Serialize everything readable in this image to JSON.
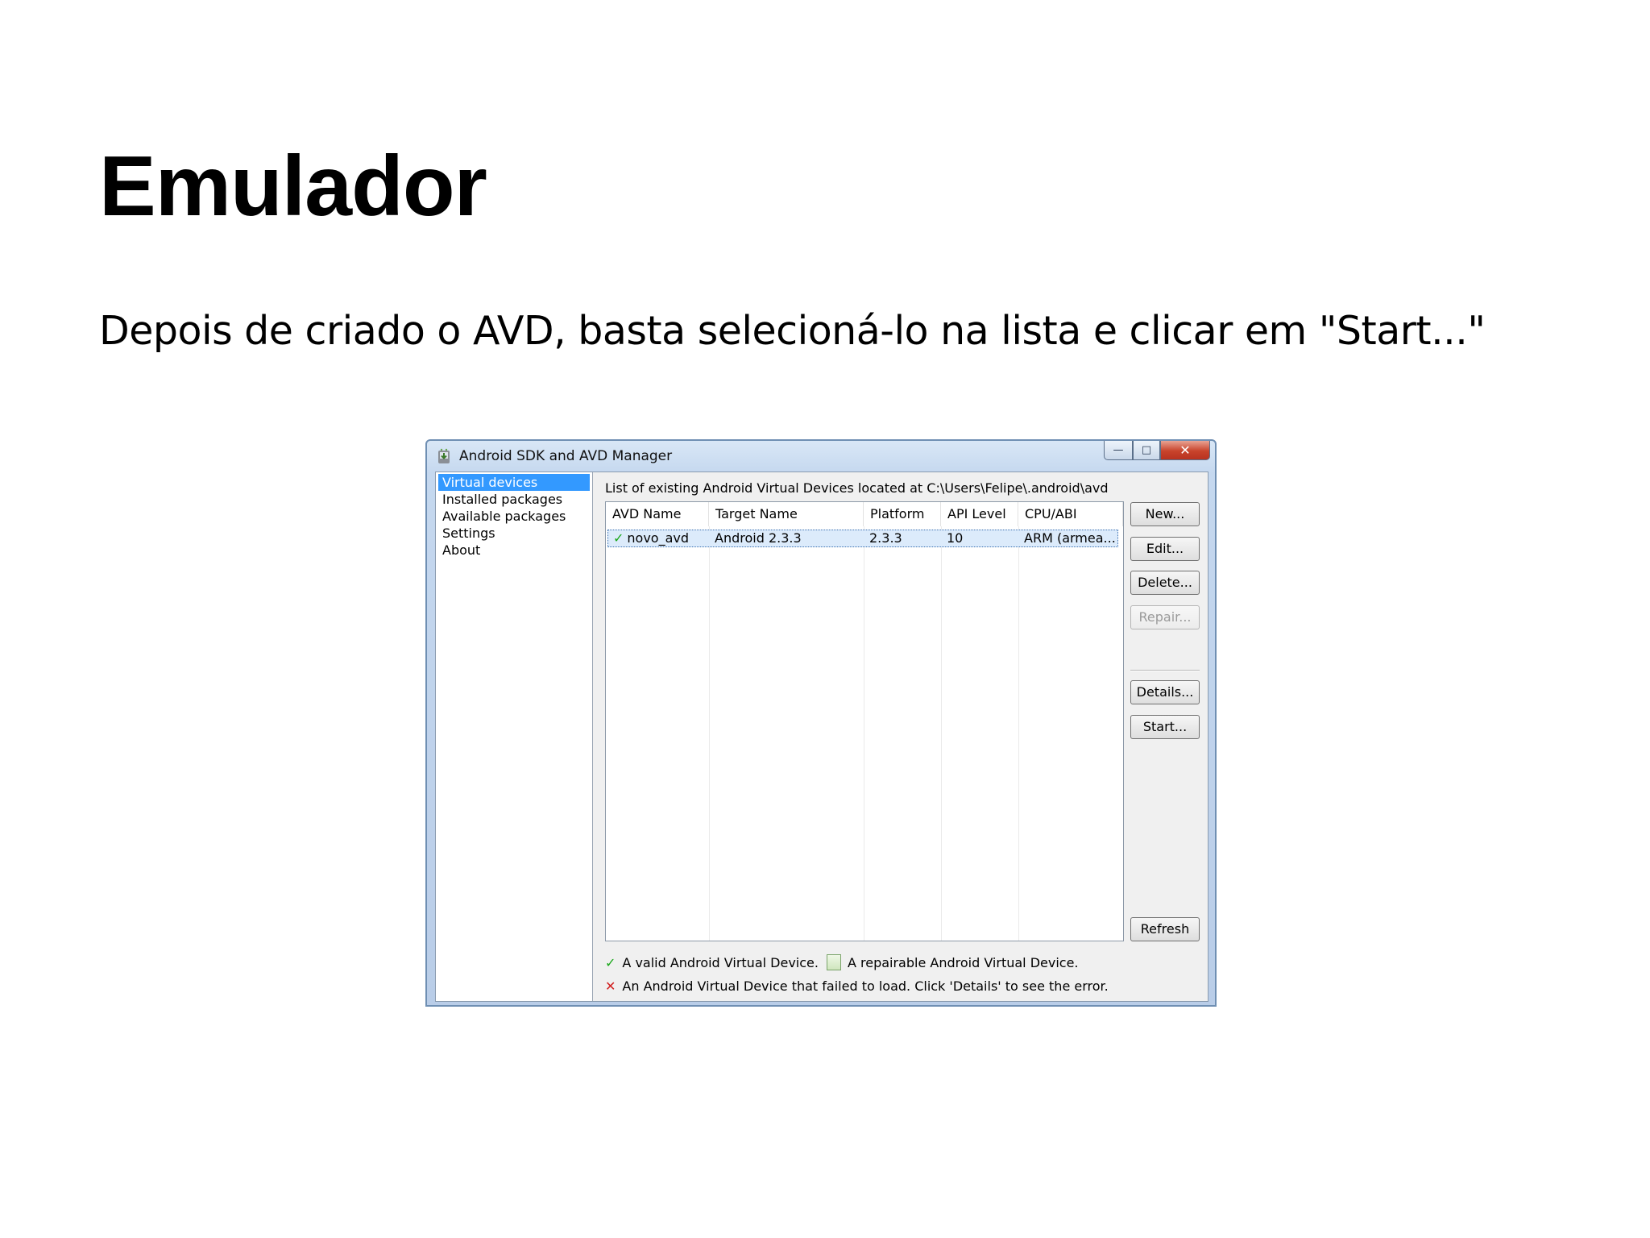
{
  "slide": {
    "title": "Emulador",
    "body": "Depois de criado o AVD, basta selecioná-lo na lista e clicar em \"Start...\""
  },
  "window": {
    "title": "Android SDK and AVD Manager",
    "controls": {
      "minimize": "—",
      "maximize": "□",
      "close": "✕"
    }
  },
  "nav": {
    "items": [
      {
        "label": "Virtual devices",
        "selected": true
      },
      {
        "label": "Installed packages",
        "selected": false
      },
      {
        "label": "Available packages",
        "selected": false
      },
      {
        "label": "Settings",
        "selected": false
      },
      {
        "label": "About",
        "selected": false
      }
    ]
  },
  "main": {
    "path_label": "List of existing Android Virtual Devices located at C:\\Users\\Felipe\\.android\\avd",
    "table": {
      "columns": [
        "AVD Name",
        "Target Name",
        "Platform",
        "API Level",
        "CPU/ABI"
      ],
      "rows": [
        {
          "status": "valid",
          "cells": [
            "novo_avd",
            "Android 2.3.3",
            "2.3.3",
            "10",
            "ARM (armea..."
          ]
        }
      ]
    },
    "buttons": {
      "new": "New...",
      "edit": "Edit...",
      "delete": "Delete...",
      "repair": "Repair...",
      "details": "Details...",
      "start": "Start...",
      "refresh": "Refresh"
    },
    "legend": {
      "valid": "A valid Android Virtual Device.",
      "repairable": "A repairable Android Virtual Device.",
      "failed": "An Android Virtual Device that failed to load. Click 'Details' to see the error."
    }
  },
  "icons": {
    "app": "android-download-icon",
    "valid": "checkmark-icon",
    "repairable": "repair-document-icon",
    "failed": "red-x-icon"
  },
  "colors": {
    "selection": "#3399ff",
    "valid": "#1aa81a",
    "failed": "#d11f1f",
    "close_button": "#c8432b"
  }
}
